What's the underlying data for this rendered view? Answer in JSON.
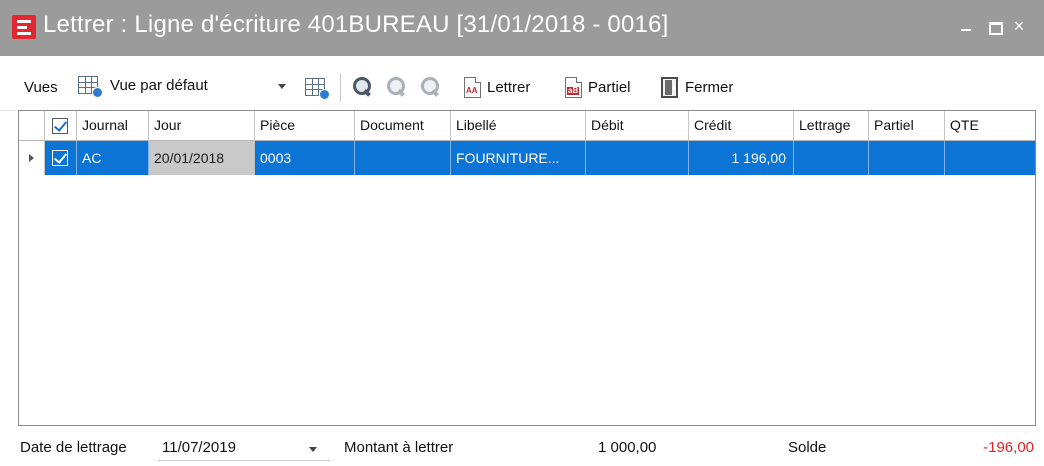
{
  "window": {
    "title": "Lettrer : Ligne d'écriture 401BUREAU [31/01/2018 - 0016]",
    "close_glyph": "×"
  },
  "toolbar": {
    "views_label": "Vues",
    "views_selected": "Vue par défaut",
    "lettrer_label": "Lettrer",
    "partiel_label": "Partiel",
    "fermer_label": "Fermer",
    "lettrer_tag": "AA",
    "partiel_tag": "aB"
  },
  "grid": {
    "columns": [
      "Journal",
      "Jour",
      "Pièce",
      "Document",
      "Libellé",
      "Débit",
      "Crédit",
      "Lettrage",
      "Partiel",
      "QTE"
    ],
    "rows": [
      {
        "selected": true,
        "checked": true,
        "journal": "AC",
        "jour": "20/01/2018",
        "piece": "0003",
        "document": "",
        "libelle": "FOURNITURE...",
        "debit": "",
        "credit": "1 196,00",
        "lettrage": "",
        "partiel": "",
        "qte": ""
      }
    ]
  },
  "footer": {
    "date_label": "Date de lettrage",
    "date_value": "11/07/2019",
    "montant_label": "Montant à lettrer",
    "montant_value": "1 000,00",
    "solde_label": "Solde",
    "solde_value": "-196,00"
  },
  "colors": {
    "titlebar": "#9b9b9b",
    "selection": "#0b74d4",
    "negative": "#e02424",
    "app_icon": "#e0282e"
  }
}
